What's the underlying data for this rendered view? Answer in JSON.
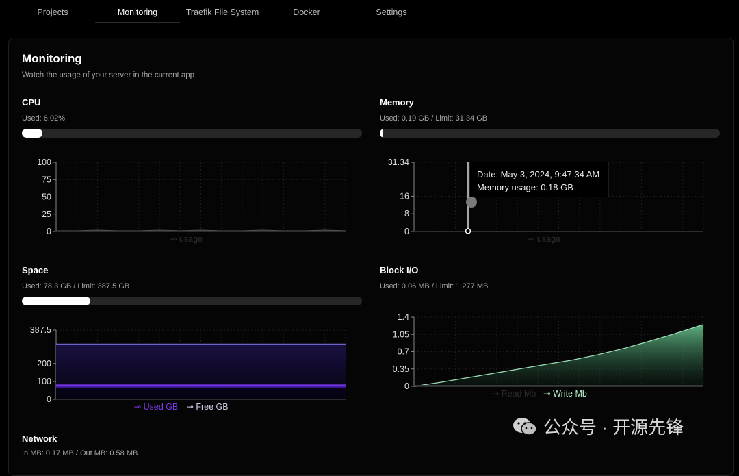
{
  "tabs": [
    {
      "label": "Projects"
    },
    {
      "label": "Monitoring",
      "active": true
    },
    {
      "label": "Traefik File System"
    },
    {
      "label": "Docker"
    },
    {
      "label": "Settings"
    }
  ],
  "page": {
    "title": "Monitoring",
    "subtitle": "Watch the usage of your server in the current app"
  },
  "cpu": {
    "title": "CPU",
    "used": "Used: 6.02%",
    "percent": 6.02,
    "chart": {
      "yticks": [
        "100",
        "75",
        "50",
        "25",
        "0"
      ],
      "legend": "usage"
    }
  },
  "memory": {
    "title": "Memory",
    "used": "Used: 0.19 GB / Limit: 31.34 GB",
    "percent": 0.6,
    "chart": {
      "yticks": [
        "31.34",
        "16",
        "8",
        "0"
      ],
      "legend": "usage"
    },
    "tooltip": {
      "date": "Date: May 3, 2024, 9:47:34 AM",
      "usage": "Memory usage: 0.18 GB"
    }
  },
  "space": {
    "title": "Space",
    "used": "Used: 78.3 GB / Limit: 387.5 GB",
    "percent": 20.2,
    "chart": {
      "yticks": [
        "387.5",
        "200",
        "100",
        "0"
      ],
      "legend_used": "Used GB",
      "legend_free": "Free GB"
    }
  },
  "blockio": {
    "title": "Block I/O",
    "used": "Used: 0.06 MB / Limit: 1.277 MB",
    "chart": {
      "yticks": [
        "1.4",
        "1.05",
        "0.7",
        "0.35",
        "0"
      ],
      "legend_read": "Read Mb",
      "legend_write": "Write Mb"
    }
  },
  "network": {
    "title": "Network",
    "used": "In MB: 0.17 MB / Out MB: 0.58 MB"
  },
  "watermark": {
    "text": "公众号 · 开源先锋"
  },
  "colors": {
    "accent_purple": "#7c3aed",
    "write_green": "#6fcf97",
    "bar_bg": "#262626"
  },
  "chart_data": [
    {
      "type": "area",
      "title": "",
      "series": [
        {
          "name": "usage",
          "values": [
            1,
            1,
            2,
            1,
            1,
            2,
            1,
            2,
            1,
            1,
            2,
            1,
            1,
            2,
            1
          ]
        }
      ],
      "ylim": [
        0,
        100
      ]
    },
    {
      "type": "line",
      "title": "",
      "series": [
        {
          "name": "usage",
          "values": [
            0.18
          ]
        }
      ],
      "ylim": [
        0,
        31.34
      ]
    },
    {
      "type": "area",
      "title": "",
      "series": [
        {
          "name": "Used GB",
          "values": [
            78.3
          ]
        },
        {
          "name": "Free GB",
          "values": [
            309.2
          ]
        }
      ],
      "ylim": [
        0,
        387.5
      ]
    },
    {
      "type": "area",
      "title": "",
      "series": [
        {
          "name": "Read Mb",
          "values": [
            0,
            0,
            0,
            0,
            0,
            0,
            0,
            0,
            0,
            0,
            0,
            0
          ]
        },
        {
          "name": "Write Mb",
          "values": [
            0,
            0.08,
            0.17,
            0.26,
            0.35,
            0.44,
            0.53,
            0.64,
            0.77,
            0.92,
            1.08,
            1.25
          ]
        }
      ],
      "ylim": [
        0,
        1.4
      ]
    }
  ]
}
